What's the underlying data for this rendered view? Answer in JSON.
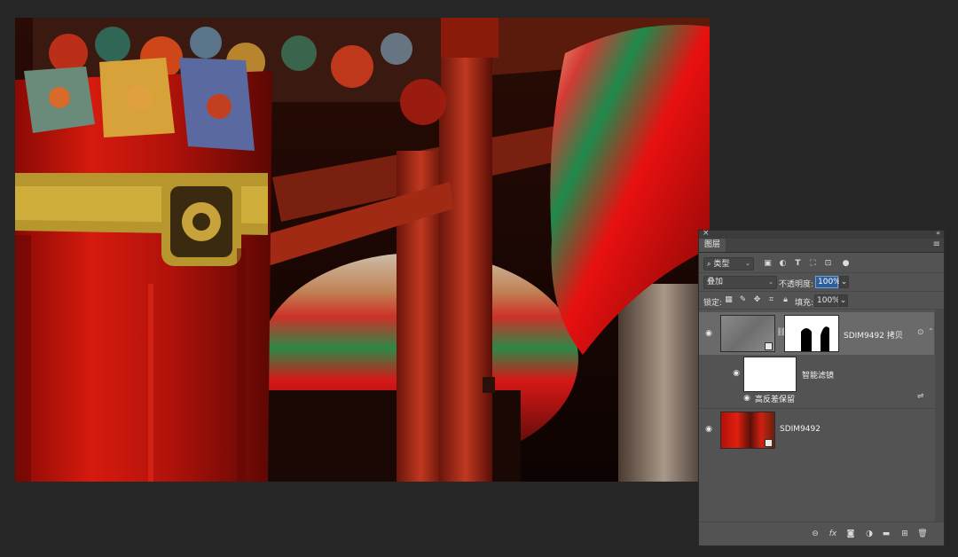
{
  "panel": {
    "tab_label": "图层",
    "filter": {
      "kind_label": "类型"
    },
    "blend_mode": "叠加",
    "opacity_label": "不透明度:",
    "opacity_value": "100%",
    "lock_label": "锁定:",
    "fill_label": "填充:",
    "fill_value": "100%"
  },
  "layers": [
    {
      "name": "SDIM9492 拷贝",
      "selected": true
    },
    {
      "name": "智能滤镜"
    },
    {
      "name": "高反差保留"
    },
    {
      "name": "SDIM9492"
    }
  ],
  "colors": {
    "accent": "#2f5f9b",
    "panel_bg": "#535353",
    "canvas_bg": "#262626"
  },
  "icons": [
    "search-icon",
    "image-filter-icon",
    "adjust-filter-icon",
    "type-filter-icon",
    "shape-filter-icon",
    "smart-object-filter-icon",
    "filter-toggle-icon",
    "lock-pixels-icon",
    "lock-paint-icon",
    "lock-move-icon",
    "lock-artboard-icon",
    "lock-all-icon",
    "eye-icon",
    "chain-link-icon",
    "filter-options-icon",
    "link-layers-icon",
    "fx-icon",
    "mask-icon",
    "adjustment-icon",
    "folder-icon",
    "new-layer-icon",
    "trash-icon"
  ]
}
